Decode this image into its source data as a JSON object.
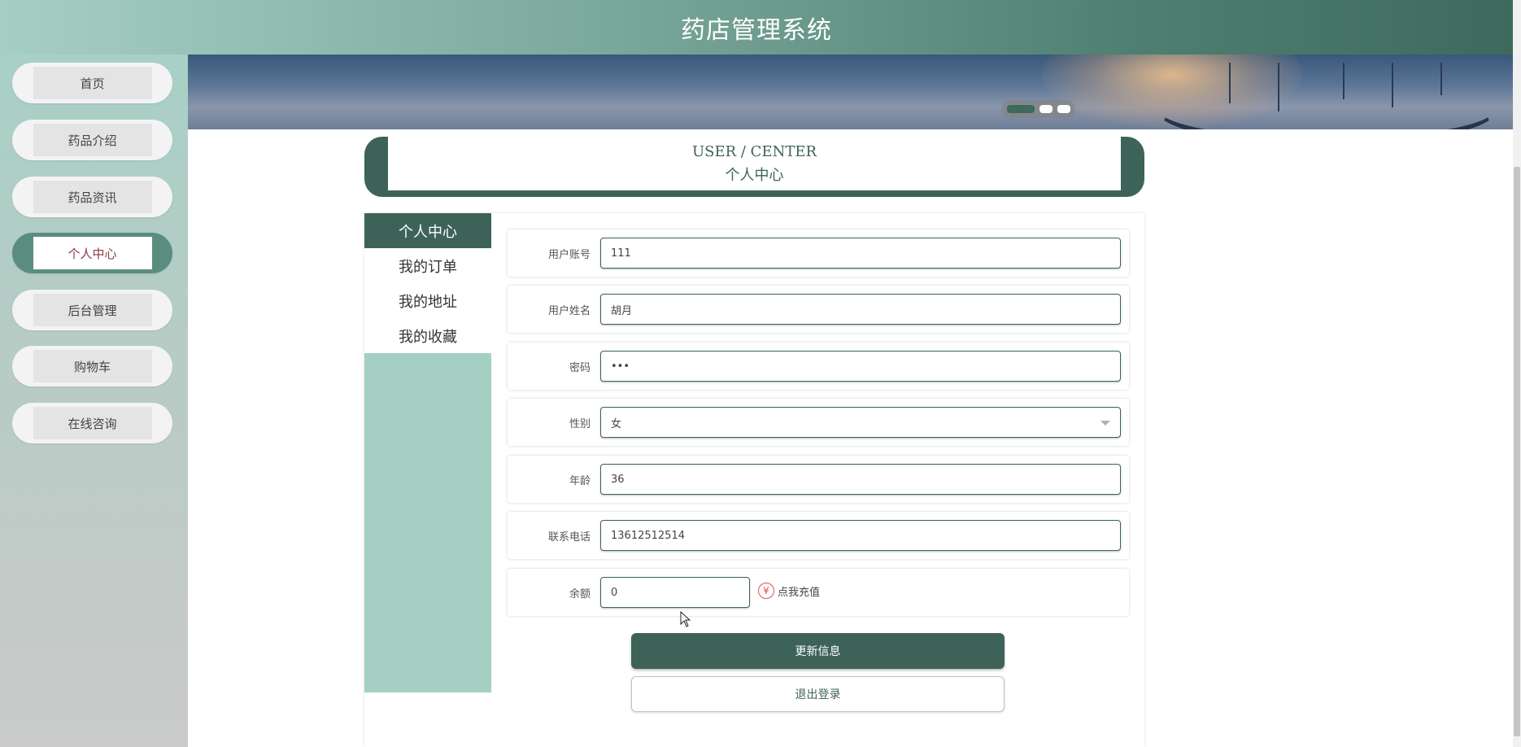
{
  "app": {
    "title": "药店管理系统"
  },
  "sidebar": {
    "items": [
      {
        "label": "首页"
      },
      {
        "label": "药品介绍"
      },
      {
        "label": "药品资讯"
      },
      {
        "label": "个人中心",
        "active": true
      },
      {
        "label": "后台管理"
      },
      {
        "label": "购物车"
      },
      {
        "label": "在线咨询"
      }
    ]
  },
  "banner": {
    "slides": 3,
    "active_slide": 1
  },
  "center_header": {
    "en": "USER / CENTER",
    "cn": "个人中心"
  },
  "menu": {
    "items": [
      {
        "label": "个人中心",
        "active": true
      },
      {
        "label": "我的订单"
      },
      {
        "label": "我的地址"
      },
      {
        "label": "我的收藏"
      }
    ]
  },
  "form": {
    "account": {
      "label": "用户账号",
      "value": "111"
    },
    "name": {
      "label": "用户姓名",
      "value": "胡月"
    },
    "password": {
      "label": "密码",
      "value": "•••"
    },
    "gender": {
      "label": "性别",
      "value": "女"
    },
    "age": {
      "label": "年龄",
      "value": "36"
    },
    "phone": {
      "label": "联系电话",
      "value": "13612512514"
    },
    "balance": {
      "label": "余额",
      "value": "0",
      "recharge_icon": "¥",
      "recharge_label": "点我充值"
    }
  },
  "buttons": {
    "update": "更新信息",
    "logout": "退出登录"
  },
  "colors": {
    "primary": "#3d6359",
    "accent_light": "#a6cfc4",
    "active_text": "#8a3b45"
  }
}
